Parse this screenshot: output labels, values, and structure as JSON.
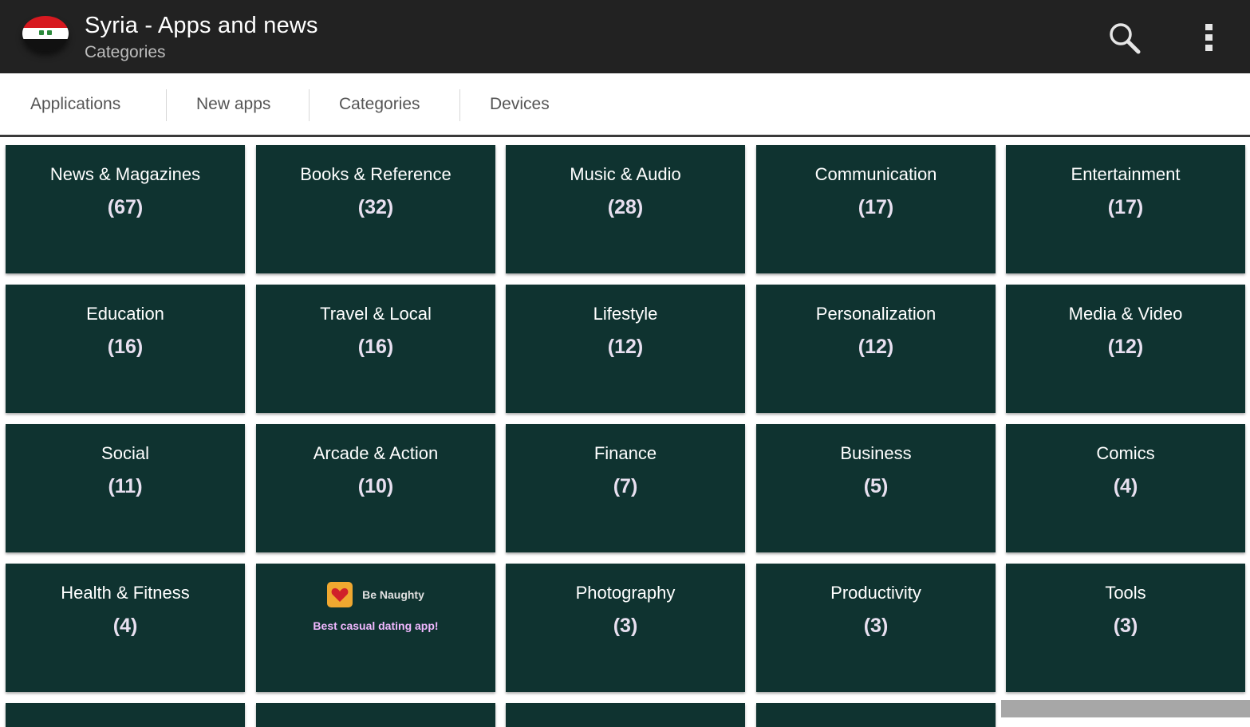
{
  "app": {
    "title": "Syria - Apps and news",
    "subtitle": "Categories"
  },
  "tabs": [
    {
      "label": "Applications"
    },
    {
      "label": "New apps"
    },
    {
      "label": "Categories"
    },
    {
      "label": "Devices"
    }
  ],
  "categories": [
    {
      "name": "News & Magazines",
      "count": "(67)"
    },
    {
      "name": "Books & Reference",
      "count": "(32)"
    },
    {
      "name": "Music & Audio",
      "count": "(28)"
    },
    {
      "name": "Communication",
      "count": "(17)"
    },
    {
      "name": "Entertainment",
      "count": "(17)"
    },
    {
      "name": "Education",
      "count": "(16)"
    },
    {
      "name": "Travel & Local",
      "count": "(16)"
    },
    {
      "name": "Lifestyle",
      "count": "(12)"
    },
    {
      "name": "Personalization",
      "count": "(12)"
    },
    {
      "name": "Media & Video",
      "count": "(12)"
    },
    {
      "name": "Social",
      "count": "(11)"
    },
    {
      "name": "Arcade & Action",
      "count": "(10)"
    },
    {
      "name": "Finance",
      "count": "(7)"
    },
    {
      "name": "Business",
      "count": "(5)"
    },
    {
      "name": "Comics",
      "count": "(4)"
    },
    {
      "name": "Health & Fitness",
      "count": "(4)"
    },
    {
      "name": "Photography",
      "count": "(3)"
    },
    {
      "name": "Productivity",
      "count": "(3)"
    },
    {
      "name": "Tools",
      "count": "(3)"
    }
  ],
  "ad": {
    "name": "Be Naughty",
    "tagline": "Best casual dating app!",
    "icon": "heart-icon"
  },
  "colors": {
    "app_bar": "#222222",
    "tile": "#0f3330",
    "count_text": "#e8e0f0",
    "ad_tagline": "#f0b8ff"
  }
}
